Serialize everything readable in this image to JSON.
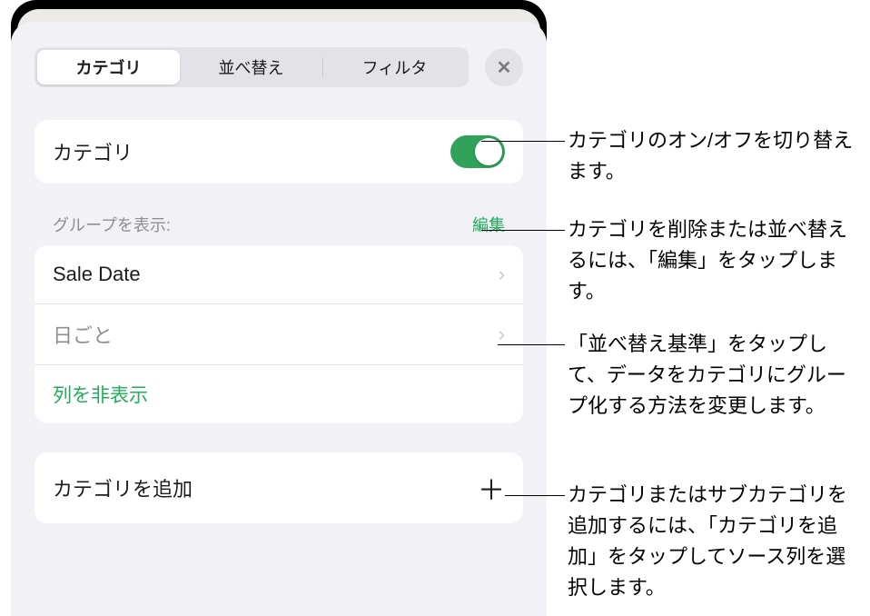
{
  "tabs": {
    "categories": "カテゴリ",
    "sort": "並べ替え",
    "filter": "フィルタ"
  },
  "toggle_row": {
    "label": "カテゴリ"
  },
  "groups_section": {
    "header": "グループを表示:",
    "edit": "編集",
    "rows": {
      "sale_date": "Sale Date",
      "by_day": "日ごと",
      "hide_column": "列を非表示"
    }
  },
  "add_category": "カテゴリを追加",
  "callouts": {
    "toggle": "カテゴリのオン/オフを切り替えます。",
    "edit": "カテゴリを削除または並べ替えるには、「編集」をタップします。",
    "sort_by": "「並べ替え基準」をタップして、データをカテゴリにグループ化する方法を変更します。",
    "add": "カテゴリまたはサブカテゴリを追加するには、「カテゴリを追加」をタップしてソース列を選択します。"
  }
}
